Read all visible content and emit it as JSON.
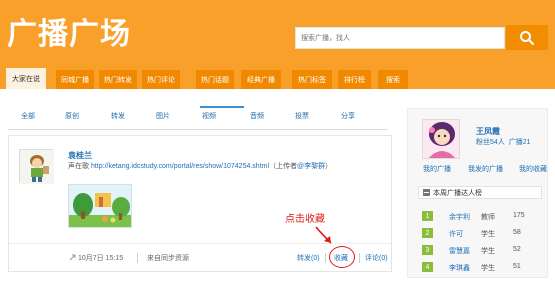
{
  "header": {
    "title": "广播广场",
    "search_placeholder": "搜索广播，找人"
  },
  "nav": {
    "tabs": [
      "大家在说",
      "同城广播",
      "热门转发",
      "热门评论",
      "热门话题",
      "经典广播",
      "热门标签",
      "排行榜",
      "搜索"
    ]
  },
  "subnav": {
    "items": [
      "全部",
      "原创",
      "转发",
      "图片",
      "视频",
      "音频",
      "投票",
      "分享"
    ],
    "active": "视频"
  },
  "post": {
    "author": "袁桂兰",
    "prefix": "声在歌",
    "link": "http://ketang.idcstudy.com/portal/res/show/1074254.shtml",
    "uploader_open": "（上传者",
    "uploader_name": "@李黎群",
    "uploader_close": "）",
    "annotation": "点击收藏",
    "time": "10月7日 15:15",
    "source": "来自同步资源",
    "forward": "转发(0)",
    "favorite": "收藏",
    "comment": "评论(0)"
  },
  "profile": {
    "name": "王凤霞",
    "fans_label": "粉丝",
    "fans_count": "54人",
    "broadcast_label": "广播",
    "broadcast_count": "21"
  },
  "profile_links": [
    "我的广播",
    "我发的广播",
    "我的收藏"
  ],
  "rank": {
    "title": "本周广播达人榜",
    "rows": [
      {
        "num": "1",
        "name": "余宇利",
        "role": "教师",
        "score": "175"
      },
      {
        "num": "2",
        "name": "许可",
        "role": "学生",
        "score": "58"
      },
      {
        "num": "3",
        "name": "雷慧嘉",
        "role": "学生",
        "score": "52"
      },
      {
        "num": "4",
        "name": "李琪鑫",
        "role": "学生",
        "score": "51"
      }
    ]
  }
}
